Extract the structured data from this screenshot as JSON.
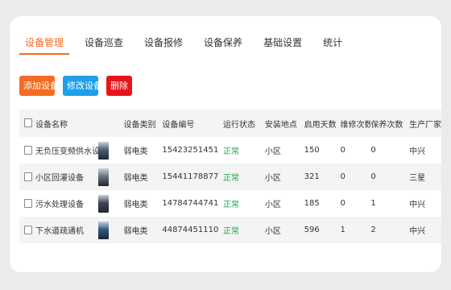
{
  "tabs": [
    {
      "label": "设备管理",
      "active": true
    },
    {
      "label": "设备巡查",
      "active": false
    },
    {
      "label": "设备报修",
      "active": false
    },
    {
      "label": "设备保养",
      "active": false
    },
    {
      "label": "基础设置",
      "active": false
    },
    {
      "label": "统计",
      "active": false
    }
  ],
  "toolbar": {
    "add_label": "添加设备",
    "edit_label": "修改设备",
    "delete_label": "删除"
  },
  "colors": {
    "accent": "#f36c21",
    "edit_blue": "#1e9fe8",
    "delete_red": "#e8141c",
    "status_green": "#1aa84a"
  },
  "table": {
    "headers": [
      "设备名称",
      "设备类别",
      "设备编号",
      "运行状态",
      "安装地点",
      "启用天数",
      "维修次数",
      "保养次数",
      "生产厂家"
    ],
    "rows": [
      {
        "name": "无负压变频供水设备",
        "type": "弱电类",
        "code": "15423251451",
        "status": "正常",
        "location": "小区",
        "days": "150",
        "repairs": "0",
        "maintenance": "0",
        "maker": "中兴",
        "thumb_color": "#4a5f78"
      },
      {
        "name": "小区回灌设备",
        "type": "弱电类",
        "code": "15441178877",
        "status": "正常",
        "location": "小区",
        "days": "321",
        "repairs": "0",
        "maintenance": "0",
        "maker": "三星",
        "thumb_color": "#6a7480"
      },
      {
        "name": "污水处理设备",
        "type": "弱电类",
        "code": "14784744741",
        "status": "正常",
        "location": "小区",
        "days": "185",
        "repairs": "0",
        "maintenance": "1",
        "maker": "中兴",
        "thumb_color": "#3f4650"
      },
      {
        "name": "下水道疏通机",
        "type": "弱电类",
        "code": "44874451110",
        "status": "正常",
        "location": "小区",
        "days": "596",
        "repairs": "1",
        "maintenance": "2",
        "maker": "中兴",
        "thumb_color": "#2f5a86"
      }
    ]
  }
}
